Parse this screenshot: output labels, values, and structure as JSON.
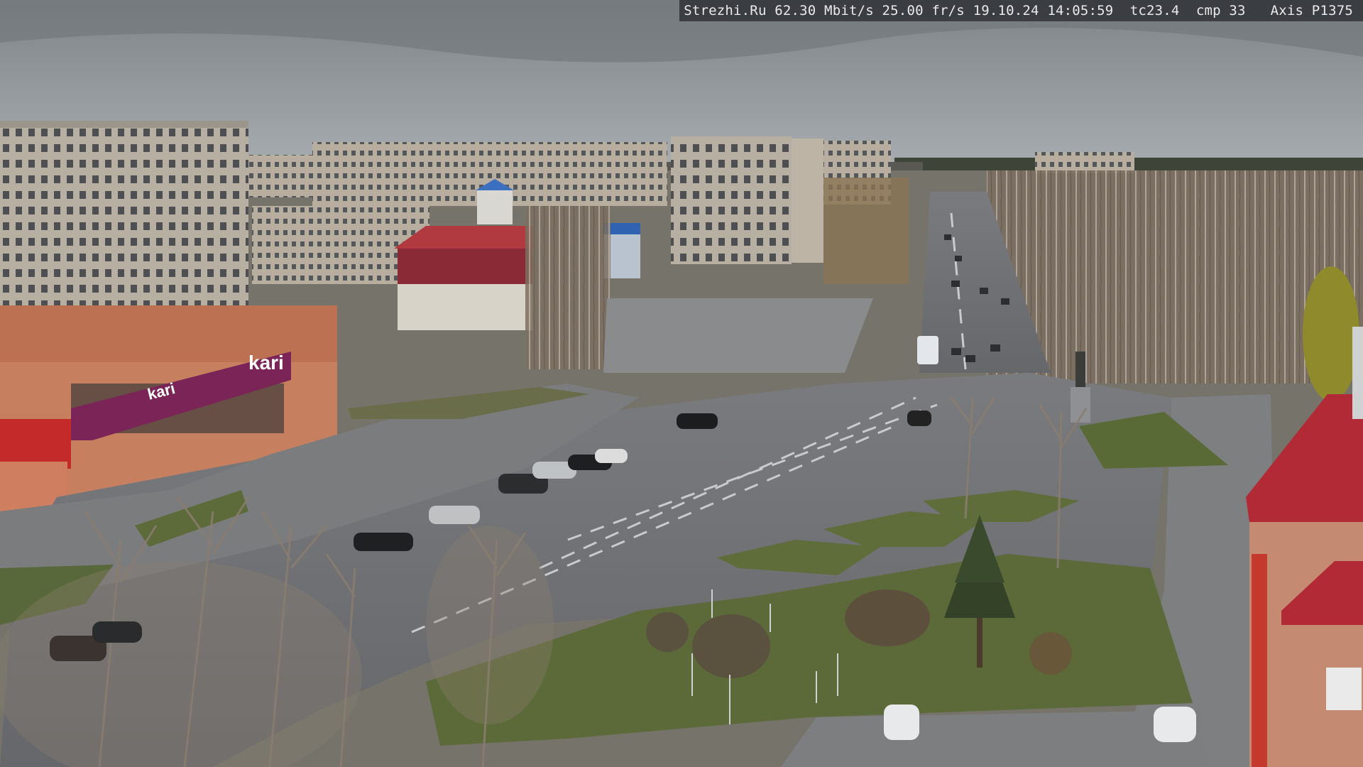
{
  "overlay": {
    "site": "Strezhi.Ru",
    "bitrate": "62.30 Mbit/s",
    "framerate": "25.00 fr/s",
    "datetime": "19.10.24 14:05:59",
    "tc": "tc23.4",
    "cmp": "cmp 33",
    "camera": "Axis P1375"
  },
  "signage": {
    "store_logo": "kari",
    "store_banner": "kari"
  },
  "colors": {
    "sky": "#8e9398",
    "road": "#6f7073",
    "grass": "#5f6b3c",
    "building_panel": "#b5aca0",
    "store_facade": "#c47a5e",
    "store_banner": "#7b2457",
    "roof_red": "#b42b33"
  }
}
